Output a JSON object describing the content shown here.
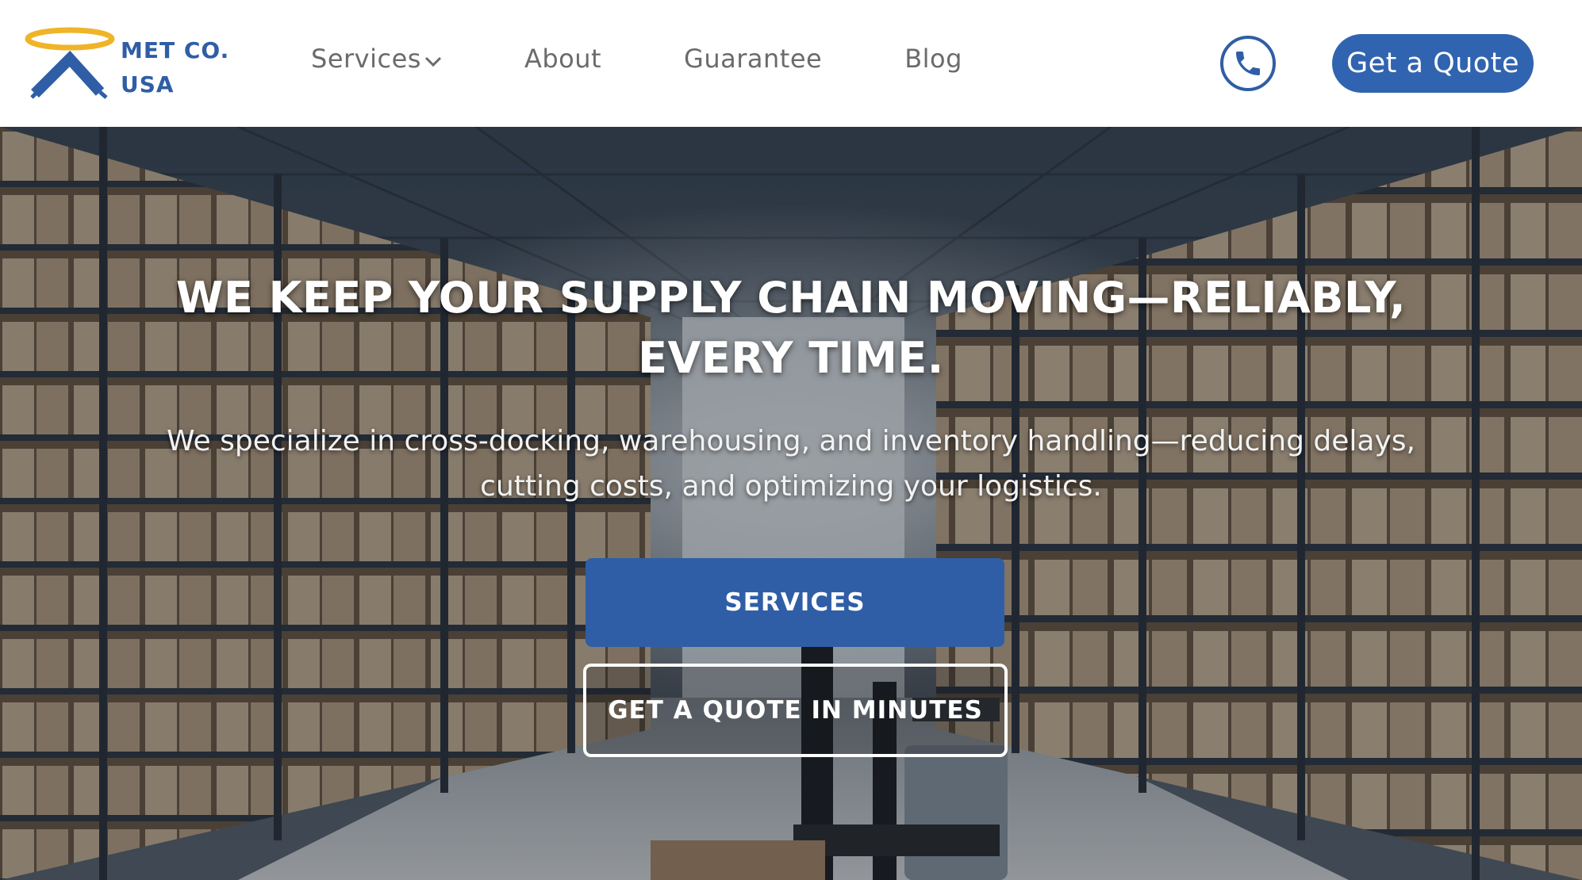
{
  "brand": {
    "line1": "MET CO.",
    "line2": "USA",
    "logo_icon": "halo-roof-logo-icon",
    "color": "#2f5ea6",
    "halo_color": "#f0b429"
  },
  "nav": {
    "items": [
      {
        "label": "Services",
        "has_dropdown": true
      },
      {
        "label": "About"
      },
      {
        "label": "Guarantee"
      },
      {
        "label": "Blog"
      }
    ]
  },
  "header": {
    "phone_icon": "phone-icon",
    "quote_label": "Get a Quote",
    "accent": "#3164b0"
  },
  "hero": {
    "background": "warehouse-aisle-with-forklift-image",
    "title": "WE KEEP YOUR SUPPLY CHAIN MOVING—RELIABLY, EVERY TIME.",
    "subtitle": "We specialize in cross-docking, warehousing, and inventory handling—reducing delays, cutting costs, and optimizing your logistics.",
    "primary_cta": "SERVICES",
    "secondary_cta": "GET A QUOTE IN MINUTES"
  }
}
